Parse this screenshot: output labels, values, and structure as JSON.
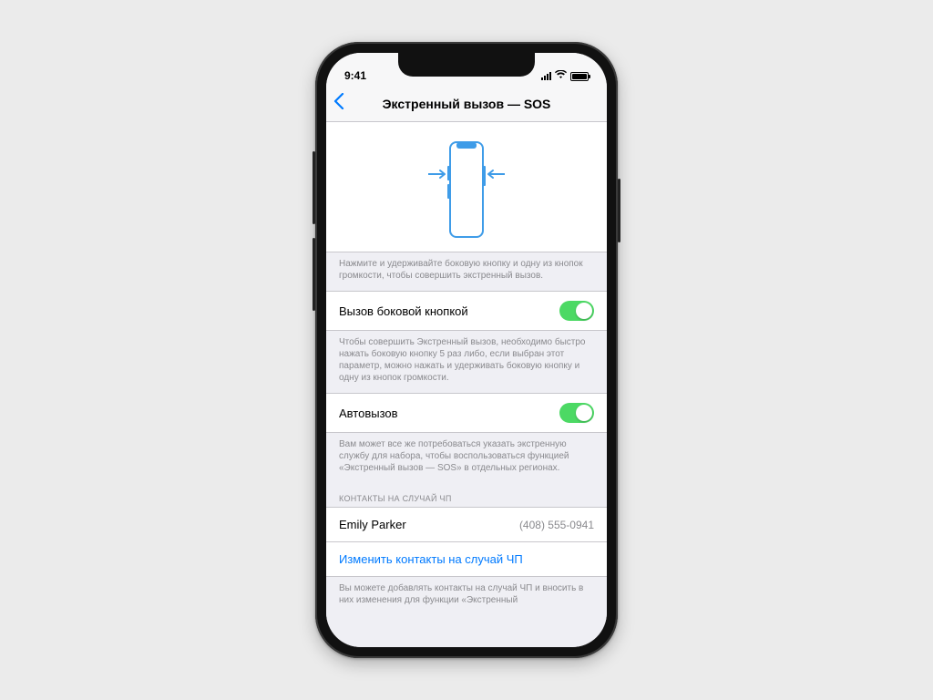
{
  "status": {
    "time": "9:41"
  },
  "nav": {
    "title": "Экстренный вызов — SOS"
  },
  "illustration_footnote": "Нажмите и удерживайте боковую кнопку и одну из кнопок громкости, чтобы совершить экстренный вызов.",
  "row_side_button": {
    "label": "Вызов боковой кнопкой",
    "on": true
  },
  "side_button_footnote": "Чтобы совершить Экстренный вызов, необходимо быстро нажать боковую кнопку 5 раз либо, если выбран этот параметр, можно нажать и удерживать боковую кнопку и одну из кнопок громкости.",
  "row_auto": {
    "label": "Автовызов",
    "on": true
  },
  "auto_footnote": "Вам может все же потребоваться указать экстренную службу для набора, чтобы воспользоваться функцией «Экстренный вызов — SOS» в отдельных регионах.",
  "contacts_header": "КОНТАКТЫ НА СЛУЧАЙ ЧП",
  "contact": {
    "name": "Emily Parker",
    "phone": "(408) 555-0941"
  },
  "edit_contacts": "Изменить контакты на случай ЧП",
  "bottom_cutoff": "Вы можете добавлять контакты на случай ЧП и вносить в них изменения для функции «Экстренный"
}
